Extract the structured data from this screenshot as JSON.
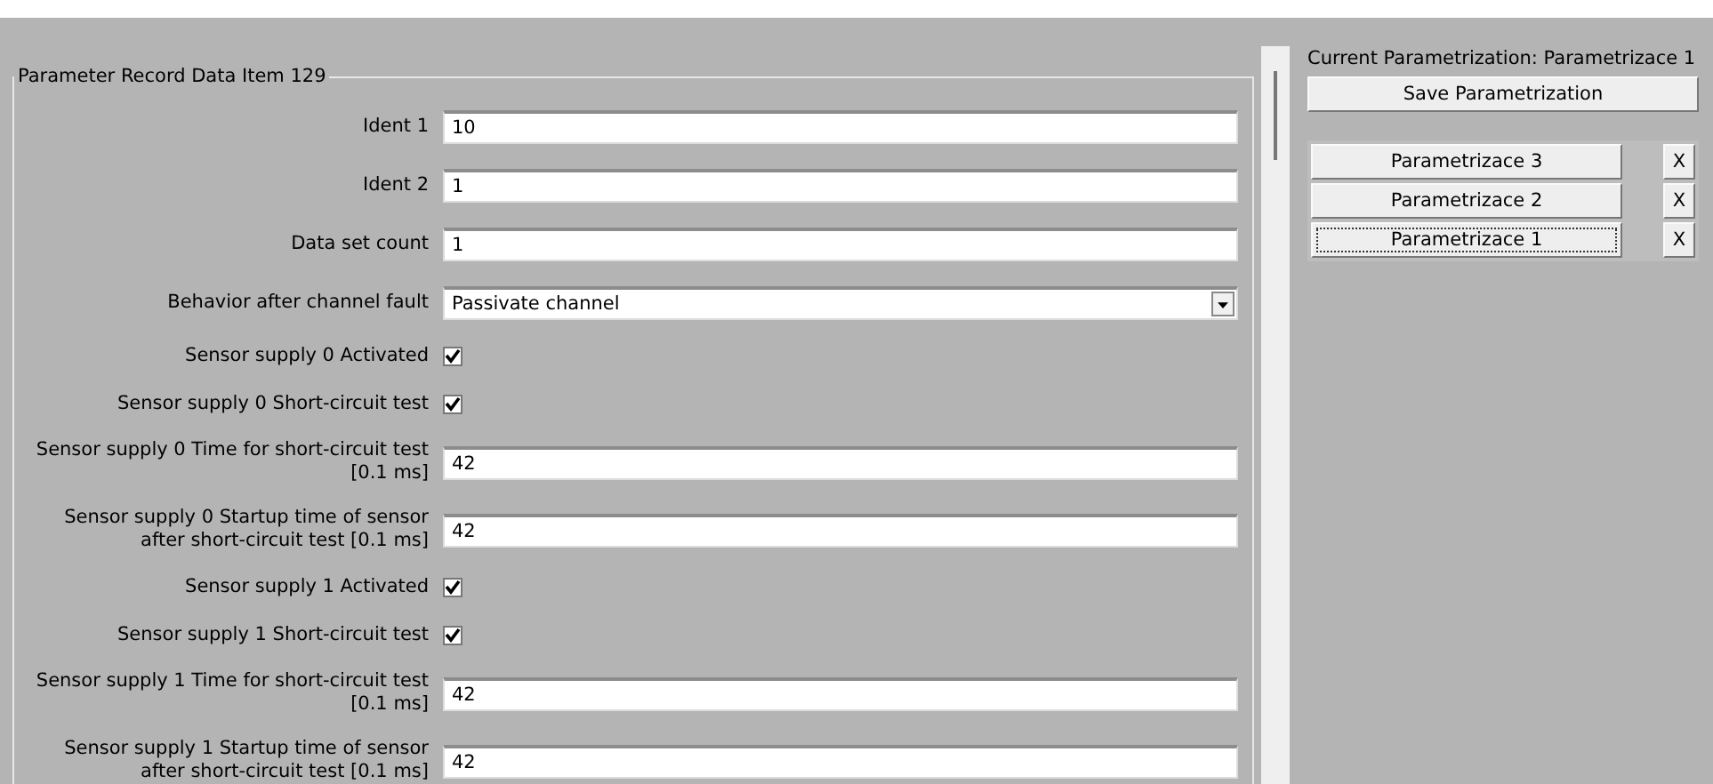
{
  "group": {
    "title": "Parameter Record Data Item 129"
  },
  "fields": [
    {
      "kind": "text",
      "label": "Ident 1",
      "value": "10"
    },
    {
      "kind": "text",
      "label": "Ident 2",
      "value": "1"
    },
    {
      "kind": "text",
      "label": "Data set count",
      "value": "1"
    },
    {
      "kind": "select",
      "label": "Behavior after channel fault",
      "value": "Passivate channel"
    },
    {
      "kind": "checkbox",
      "label": "Sensor supply 0 Activated",
      "checked": true
    },
    {
      "kind": "checkbox",
      "label": "Sensor supply 0 Short-circuit test",
      "checked": true
    },
    {
      "kind": "text",
      "label": "Sensor supply 0 Time for short-circuit test [0.1 ms]",
      "value": "42"
    },
    {
      "kind": "text",
      "label": "Sensor supply 0 Startup time of sensor after short-circuit test [0.1 ms]",
      "value": "42"
    },
    {
      "kind": "checkbox",
      "label": "Sensor supply 1 Activated",
      "checked": true
    },
    {
      "kind": "checkbox",
      "label": "Sensor supply 1 Short-circuit test",
      "checked": true
    },
    {
      "kind": "text",
      "label": "Sensor supply 1 Time for short-circuit test [0.1 ms]",
      "value": "42"
    },
    {
      "kind": "text",
      "label": "Sensor supply 1 Startup time of sensor after short-circuit test [0.1 ms]",
      "value": "42"
    }
  ],
  "side": {
    "current": "Current Parametrization: Parametrizace 1",
    "save_button": "Save Parametrization",
    "items": [
      {
        "label": "Parametrizace 3",
        "delete": "X",
        "selected": false
      },
      {
        "label": "Parametrizace 2",
        "delete": "X",
        "selected": false
      },
      {
        "label": "Parametrizace 1",
        "delete": "X",
        "selected": true
      }
    ]
  }
}
